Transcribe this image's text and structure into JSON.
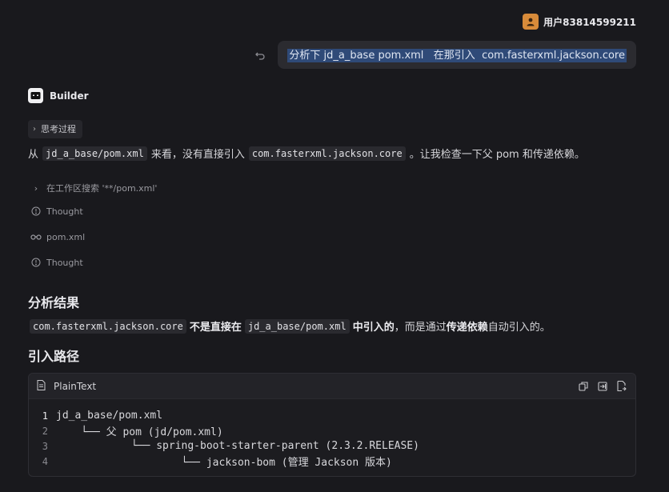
{
  "user": {
    "name": "用户83814599211",
    "message": "分析下 jd_a_base pom.xml   在那引入  com.fasterxml.jackson.core"
  },
  "assistant": {
    "name": "Builder",
    "thinking_label": "思考过程",
    "intro": {
      "prefix": "从",
      "code1": "jd_a_base/pom.xml",
      "middle": "来看，没有直接引入",
      "code2": "com.fasterxml.jackson.core",
      "suffix": "。让我检查一下父 pom 和传递依赖。"
    },
    "steps": [
      {
        "icon": "chevron-right-icon",
        "label": "在工作区搜索 '**/pom.xml'"
      },
      {
        "icon": "info-icon",
        "label": "Thought"
      },
      {
        "icon": "glasses-icon",
        "label": "pom.xml"
      },
      {
        "icon": "info-icon",
        "label": "Thought"
      }
    ],
    "result_heading": "分析结果",
    "result": {
      "code1": "com.fasterxml.jackson.core",
      "bold1": "不是直接在",
      "code2": "jd_a_base/pom.xml",
      "bold2": "中引入的",
      "text1": "，而是通过",
      "bold3": "传递依赖",
      "text2": "自动引入的。"
    },
    "path_heading": "引入路径",
    "codeblock": {
      "language": "PlainText",
      "lines": [
        {
          "num": "1",
          "text": "jd_a_base/pom.xml"
        },
        {
          "num": "2",
          "text": "    └── 父 pom (jd/pom.xml)"
        },
        {
          "num": "3",
          "text": "            └── spring-boot-starter-parent (2.3.2.RELEASE)"
        },
        {
          "num": "4",
          "text": "                    └── jackson-bom (管理 Jackson 版本)"
        }
      ]
    }
  },
  "colors": {
    "background": "#19191d",
    "bubble": "#2b2b30",
    "selection": "#2f4a78",
    "avatar": "#d88b3a"
  }
}
